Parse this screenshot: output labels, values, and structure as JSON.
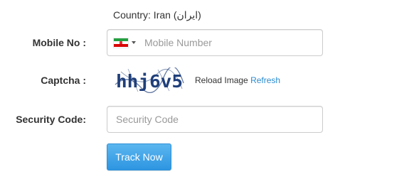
{
  "country": {
    "text": "Country: Iran (ایران)"
  },
  "mobile": {
    "label": "Mobile No :",
    "placeholder": "Mobile Number",
    "value": "",
    "flag_icon": "iran-flag-icon",
    "flag_colors": [
      "#239f40",
      "#ffffff",
      "#da0000"
    ]
  },
  "captcha": {
    "label": "Captcha :",
    "text": "hhj6v5",
    "text_color": "#1f3f7a",
    "reload_label": "Reload Image",
    "refresh_label": "Refresh",
    "refresh_color": "#2a8bd0"
  },
  "security": {
    "label": "Security Code:",
    "placeholder": "Security Code",
    "value": ""
  },
  "submit": {
    "label": "Track Now",
    "color": "#2d95e1"
  }
}
